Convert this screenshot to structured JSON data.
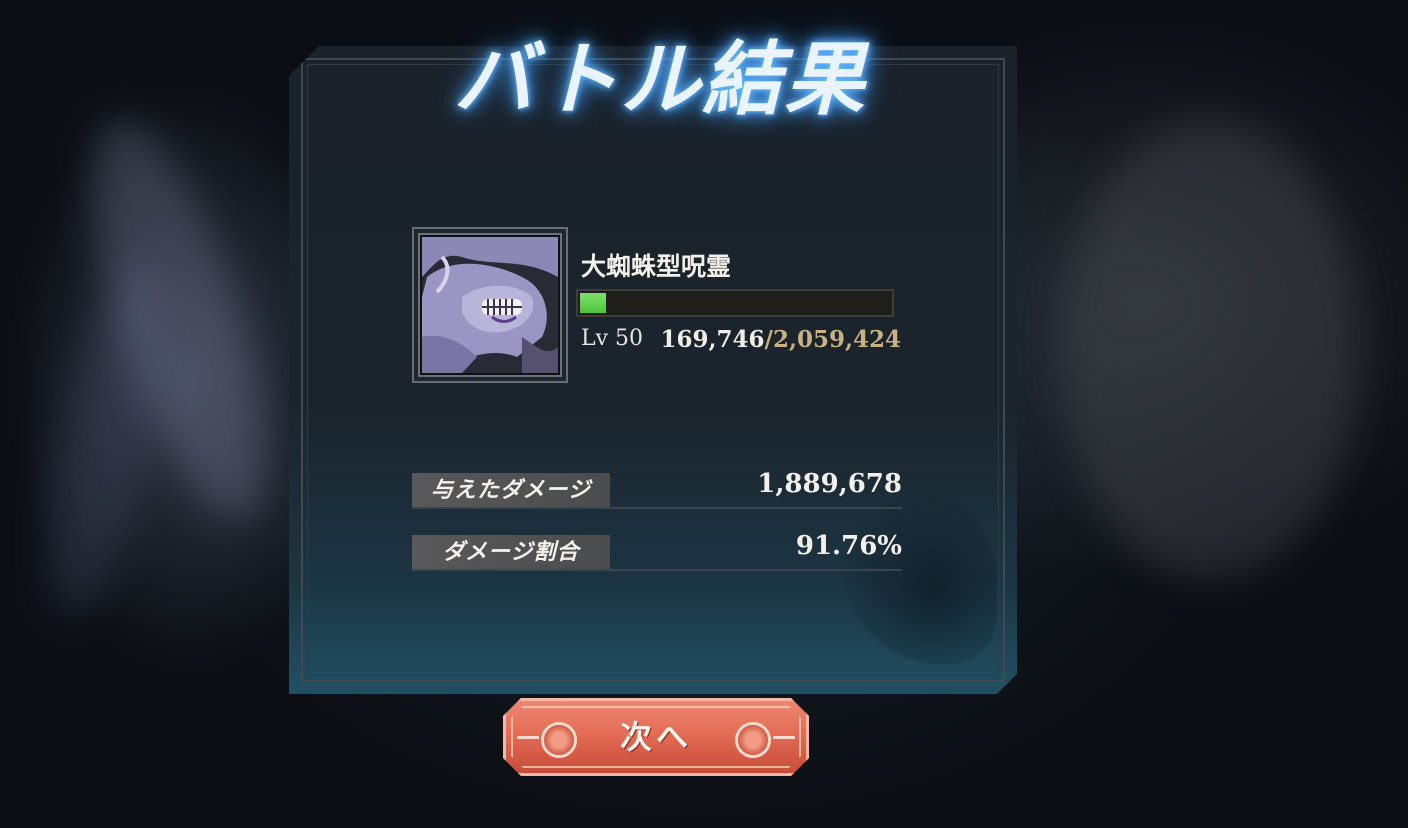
{
  "screen": {
    "title": "バトル結果"
  },
  "enemy": {
    "name": "大蜘蛛型呪霊",
    "level_label": "Lv 50",
    "hp_current": "169,746",
    "hp_separator": "/",
    "hp_max": "2,059,424",
    "hp_fraction": 0.0824,
    "portrait_icon": "spider-curse-portrait"
  },
  "stats": [
    {
      "label": "与えたダメージ",
      "value": "1,889,678"
    },
    {
      "label": "ダメージ割合",
      "value": "91.76%"
    }
  ],
  "buttons": {
    "next_label": "次へ"
  },
  "colors": {
    "title_glow": "#4aa3ff",
    "hp_bar": "#4fc53d",
    "hp_max_text": "#c9b281",
    "button": "#e36c55"
  }
}
